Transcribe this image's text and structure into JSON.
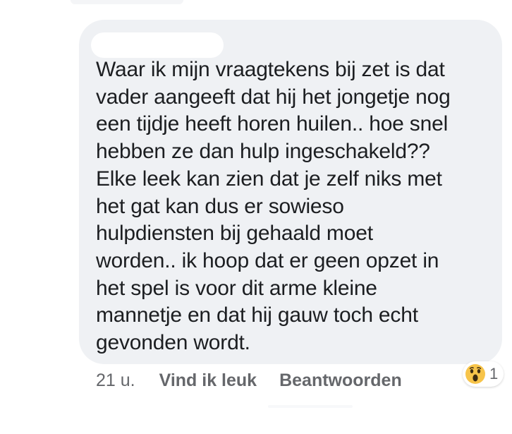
{
  "comment": {
    "author_name": "",
    "lines": [
      "Waar ik mijn vraagtekens bij zet is dat",
      "vader aangeeft dat hij het jongetje nog",
      "een tijdje heeft horen huilen.. hoe snel",
      "hebben ze dan hulp ingeschakeld??",
      "Elke leek kan zien dat je zelf niks met",
      "het gat kan dus er sowieso",
      "hulpdiensten bij gehaald moet",
      "worden.. ik hoop dat er geen opzet in",
      "het spel is voor dit arme kleine",
      "mannetje en dat hij gauw toch echt",
      "gevonden wordt."
    ]
  },
  "actions": {
    "timestamp": "21 u.",
    "like_label": "Vind ik leuk",
    "reply_label": "Beantwoorden"
  },
  "reaction": {
    "icon": "wow-emoji-icon",
    "count": "1"
  },
  "colors": {
    "bubble_bg": "#eff1f4",
    "text": "#1c1e21",
    "secondary_text": "#65676b",
    "emoji_yellow": "#f7c44a"
  }
}
